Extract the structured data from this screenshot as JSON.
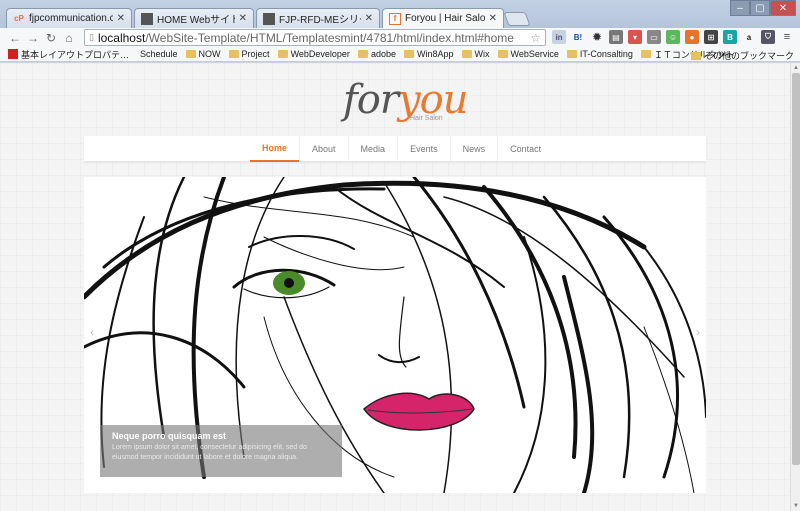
{
  "tabs": [
    {
      "favicon": "fp-favicon",
      "title": "fjpcommunication.com"
    },
    {
      "favicon": "page-favicon",
      "title": "HOME Webサイト製品カ"
    },
    {
      "favicon": "page-favicon",
      "title": "FJP-RFD-MEシリーズ【従"
    },
    {
      "favicon": "salon-favicon",
      "title": "Foryou | Hair Salon"
    }
  ],
  "address": {
    "protocol_host": "localhost",
    "path": "/WebSite-Template/HTML/Templatesmint/4781/html/index.html#home"
  },
  "bookmarks": [
    "基本レイアウトプロパテ…",
    "Schedule",
    "NOW",
    "Project",
    "WebDeveloper",
    "adobe",
    "Win8App",
    "Wix",
    "WebService",
    "IT-Consalting",
    "ＩＴコンサルタント"
  ],
  "bookmarks_other": "その他のブックマーク",
  "more_bookmarks": "»",
  "site": {
    "logo_part1": "for",
    "logo_part2": "you",
    "logo_sub": "Hair Salon",
    "menu": [
      "Home",
      "About",
      "Media",
      "Events",
      "News",
      "Contact"
    ],
    "slider": {
      "prev": "‹",
      "next": "›",
      "caption_title": "Neque porro quisquam est",
      "caption_text": "Lorem ipsum dolor sit amet, consectetur adipisicing elit, sed do eiusmod tempor incididunt ut labore et dolore magna aliqua."
    }
  },
  "colors": {
    "accent": "#e8742a",
    "lips": "#d6246a",
    "eye": "#4a8a2a"
  }
}
